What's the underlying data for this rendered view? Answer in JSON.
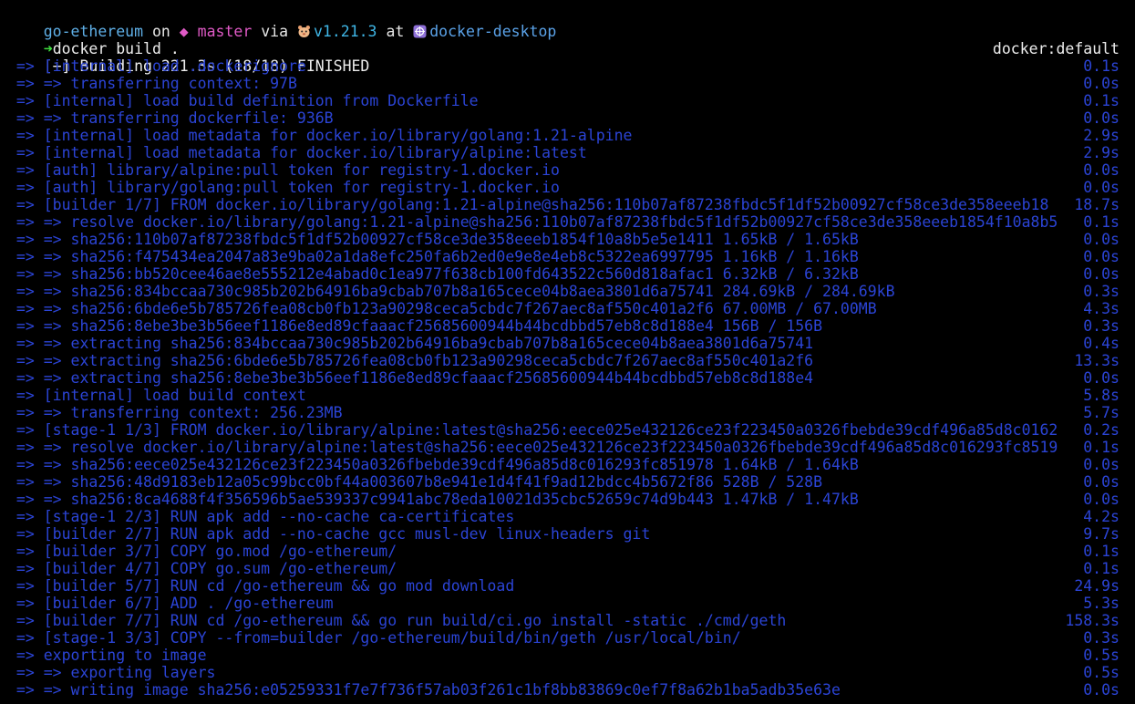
{
  "prompt": {
    "dir": "go-ethereum",
    "on": "on",
    "branch_symbol": "◆",
    "branch": "master",
    "via": "via",
    "go_version": "v1.21.3",
    "at": "at",
    "context": "docker-desktop",
    "arrow": "➜",
    "command": "docker build ."
  },
  "header": {
    "left": "[+] Building 221.3s (18/18) FINISHED",
    "right": "docker:default"
  },
  "lines": [
    {
      "text": " => [internal] load .dockerignore",
      "time": "0.1s"
    },
    {
      "text": " => => transferring context: 97B",
      "time": "0.0s"
    },
    {
      "text": " => [internal] load build definition from Dockerfile",
      "time": "0.1s"
    },
    {
      "text": " => => transferring dockerfile: 936B",
      "time": "0.0s"
    },
    {
      "text": " => [internal] load metadata for docker.io/library/golang:1.21-alpine",
      "time": "2.9s"
    },
    {
      "text": " => [internal] load metadata for docker.io/library/alpine:latest",
      "time": "2.9s"
    },
    {
      "text": " => [auth] library/alpine:pull token for registry-1.docker.io",
      "time": "0.0s"
    },
    {
      "text": " => [auth] library/golang:pull token for registry-1.docker.io",
      "time": "0.0s"
    },
    {
      "text": " => [builder 1/7] FROM docker.io/library/golang:1.21-alpine@sha256:110b07af87238fbdc5f1df52b00927cf58ce3de358eeeb18",
      "time": "18.7s"
    },
    {
      "text": " => => resolve docker.io/library/golang:1.21-alpine@sha256:110b07af87238fbdc5f1df52b00927cf58ce3de358eeeb1854f10a8b5",
      "time": "0.1s"
    },
    {
      "text": " => => sha256:110b07af87238fbdc5f1df52b00927cf58ce3de358eeeb1854f10a8b5e5e1411 1.65kB / 1.65kB",
      "time": "0.0s"
    },
    {
      "text": " => => sha256:f475434ea2047a83e9ba02a1da8efc250fa6b2ed0e9e8e4eb8c5322ea6997795 1.16kB / 1.16kB",
      "time": "0.0s"
    },
    {
      "text": " => => sha256:bb520cee46ae8e555212e4abad0c1ea977f638cb100fd643522c560d818afac1 6.32kB / 6.32kB",
      "time": "0.0s"
    },
    {
      "text": " => => sha256:834bccaa730c985b202b64916ba9cbab707b8a165cece04b8aea3801d6a75741 284.69kB / 284.69kB",
      "time": "0.3s"
    },
    {
      "text": " => => sha256:6bde6e5b785726fea08cb0fb123a90298ceca5cbdc7f267aec8af550c401a2f6 67.00MB / 67.00MB",
      "time": "4.3s"
    },
    {
      "text": " => => sha256:8ebe3be3b56eef1186e8ed89cfaaacf25685600944b44bcdbbd57eb8c8d188e4 156B / 156B",
      "time": "0.3s"
    },
    {
      "text": " => => extracting sha256:834bccaa730c985b202b64916ba9cbab707b8a165cece04b8aea3801d6a75741",
      "time": "0.4s"
    },
    {
      "text": " => => extracting sha256:6bde6e5b785726fea08cb0fb123a90298ceca5cbdc7f267aec8af550c401a2f6",
      "time": "13.3s"
    },
    {
      "text": " => => extracting sha256:8ebe3be3b56eef1186e8ed89cfaaacf25685600944b44bcdbbd57eb8c8d188e4",
      "time": "0.0s"
    },
    {
      "text": " => [internal] load build context",
      "time": "5.8s"
    },
    {
      "text": " => => transferring context: 256.23MB",
      "time": "5.7s"
    },
    {
      "text": " => [stage-1 1/3] FROM docker.io/library/alpine:latest@sha256:eece025e432126ce23f223450a0326fbebde39cdf496a85d8c0162",
      "time": "0.2s"
    },
    {
      "text": " => => resolve docker.io/library/alpine:latest@sha256:eece025e432126ce23f223450a0326fbebde39cdf496a85d8c016293fc8519",
      "time": "0.1s"
    },
    {
      "text": " => => sha256:eece025e432126ce23f223450a0326fbebde39cdf496a85d8c016293fc851978 1.64kB / 1.64kB",
      "time": "0.0s"
    },
    {
      "text": " => => sha256:48d9183eb12a05c99bcc0bf44a003607b8e941e1d4f41f9ad12bdcc4b5672f86 528B / 528B",
      "time": "0.0s"
    },
    {
      "text": " => => sha256:8ca4688f4f356596b5ae539337c9941abc78eda10021d35cbc52659c74d9b443 1.47kB / 1.47kB",
      "time": "0.0s"
    },
    {
      "text": " => [stage-1 2/3] RUN apk add --no-cache ca-certificates",
      "time": "4.2s"
    },
    {
      "text": " => [builder 2/7] RUN apk add --no-cache gcc musl-dev linux-headers git",
      "time": "9.7s"
    },
    {
      "text": " => [builder 3/7] COPY go.mod /go-ethereum/",
      "time": "0.1s"
    },
    {
      "text": " => [builder 4/7] COPY go.sum /go-ethereum/",
      "time": "0.1s"
    },
    {
      "text": " => [builder 5/7] RUN cd /go-ethereum && go mod download",
      "time": "24.9s"
    },
    {
      "text": " => [builder 6/7] ADD . /go-ethereum",
      "time": "5.3s"
    },
    {
      "text": " => [builder 7/7] RUN cd /go-ethereum && go run build/ci.go install -static ./cmd/geth",
      "time": "158.3s"
    },
    {
      "text": " => [stage-1 3/3] COPY --from=builder /go-ethereum/build/bin/geth /usr/local/bin/",
      "time": "0.3s"
    },
    {
      "text": " => exporting to image",
      "time": "0.5s"
    },
    {
      "text": " => => exporting layers",
      "time": "0.5s"
    },
    {
      "text": " => => writing image sha256:e05259331f7e7f736f57ab03f261c1bf8bb83869c0ef7f8a62b1ba5adb35e63e",
      "time": "0.0s"
    }
  ],
  "icons": {
    "go": "gopher-icon",
    "context": "kubernetes-icon"
  }
}
